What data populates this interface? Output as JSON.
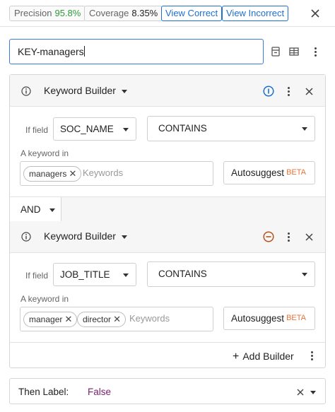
{
  "topbar": {
    "precision_label": "Precision",
    "precision_value": "95.8%",
    "coverage_label": "Coverage",
    "coverage_value": "8.35%",
    "view_correct": "View Correct",
    "view_incorrect": "View Incorrect",
    "close_icon": "close-icon",
    "precision_color": "#2e9a3a",
    "coverage_color": "#222222"
  },
  "rule": {
    "name_value": "KEY-managers",
    "icons": [
      "bookmark-icon",
      "table-icon",
      "more-vert-icon"
    ]
  },
  "builders": [
    {
      "title": "Keyword Builder",
      "status_icon": "info-circle-icon",
      "if_field_label": "If field",
      "field": "SOC_NAME",
      "operator": "CONTAINS",
      "keyword_label": "A keyword in",
      "keywords": [
        "managers"
      ],
      "keyword_placeholder": "Keywords",
      "autosuggest": "Autosuggest",
      "beta": "BETA"
    },
    {
      "title": "Keyword Builder",
      "status_icon": "remove-circle-icon",
      "if_field_label": "If field",
      "field": "JOB_TITLE",
      "operator": "CONTAINS",
      "keyword_label": "A keyword in",
      "keywords": [
        "manager",
        "director"
      ],
      "keyword_placeholder": "Keywords",
      "autosuggest": "Autosuggest",
      "beta": "BETA"
    }
  ],
  "combinator": "AND",
  "add_builder": "Add Builder",
  "then": {
    "label": "Then Label:",
    "value": "False"
  },
  "colors": {
    "accent": "#1e6fcf",
    "beta": "#e5743b",
    "remove": "#b5561e",
    "label_value": "#7a1f6b"
  }
}
